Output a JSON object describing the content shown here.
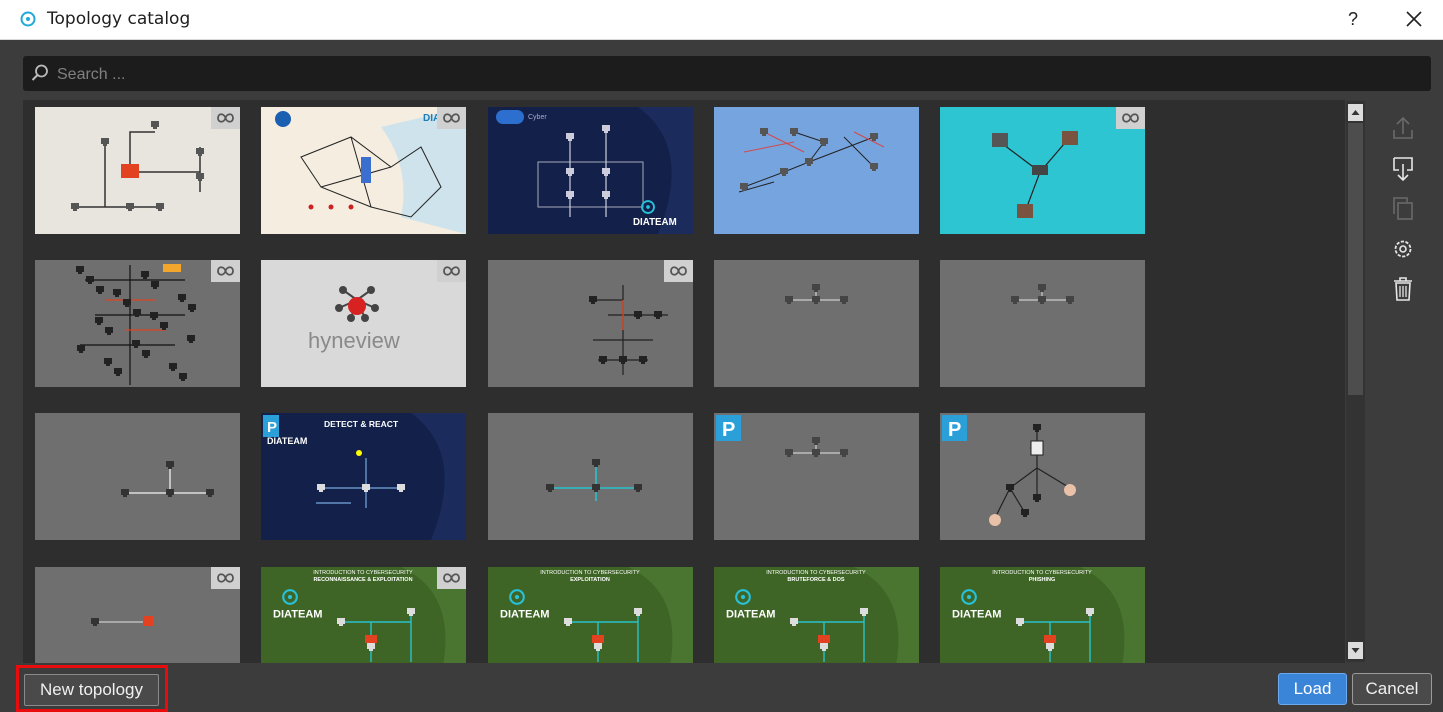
{
  "window": {
    "title": "Topology catalog",
    "help_label": "?",
    "close_label": "✕"
  },
  "search": {
    "placeholder": "Search ...",
    "value": ""
  },
  "catalog": {
    "tiles": [
      {
        "style": "light-network",
        "badge": "infinity"
      },
      {
        "style": "map-network",
        "logo_text": "DIATEAM",
        "badge": "infinity"
      },
      {
        "style": "diateam-dark",
        "logo_text": "DIATEAM",
        "header_text": "Cyber"
      },
      {
        "style": "blue-network"
      },
      {
        "style": "cyan-network",
        "badge": "infinity"
      },
      {
        "style": "dense-network",
        "badge": "infinity"
      },
      {
        "style": "hyneview",
        "logo_text": "hyneview",
        "badge": "infinity"
      },
      {
        "style": "gray-tree",
        "badge": "infinity"
      },
      {
        "style": "gray-simple"
      },
      {
        "style": "gray-simple"
      },
      {
        "style": "gray-hosts"
      },
      {
        "style": "detect-react",
        "header_text": "DETECT & REACT",
        "logo_text": "DIATEAM",
        "badge": "P"
      },
      {
        "style": "gray-hosts-3"
      },
      {
        "style": "gray-simple",
        "badge": "P"
      },
      {
        "style": "gray-firewall",
        "badge": "P"
      },
      {
        "style": "gray-link",
        "badge": "infinity"
      },
      {
        "style": "green",
        "header_text": "INTRODUCTION TO CYBERSECURITY",
        "subheader_text": "RECONNAISSANCE & EXPLOITATION",
        "logo_text": "DIATEAM",
        "badge": "infinity"
      },
      {
        "style": "green",
        "header_text": "INTRODUCTION TO CYBERSECURITY",
        "subheader_text": "EXPLOITATION",
        "logo_text": "DIATEAM"
      },
      {
        "style": "green",
        "header_text": "INTRODUCTION TO CYBERSECURITY",
        "subheader_text": "BRUTEFORCE & DOS",
        "logo_text": "DIATEAM"
      },
      {
        "style": "green",
        "header_text": "INTRODUCTION TO CYBERSECURITY",
        "subheader_text": "PHISHING",
        "logo_text": "DIATEAM"
      }
    ]
  },
  "tools": [
    {
      "name": "export-icon",
      "enabled": false
    },
    {
      "name": "import-icon",
      "enabled": true
    },
    {
      "name": "duplicate-icon",
      "enabled": false
    },
    {
      "name": "settings-icon",
      "enabled": true
    },
    {
      "name": "delete-icon",
      "enabled": true
    }
  ],
  "footer": {
    "new_label": "New topology",
    "load_label": "Load",
    "cancel_label": "Cancel"
  },
  "colors": {
    "accent": "#3b85d8",
    "highlight": "#e80c0c",
    "diateam_navy": "#13204a",
    "green_slide": "#3e6525",
    "cyan_slide": "#2ec5d3",
    "blue_slide": "#76a4de"
  }
}
